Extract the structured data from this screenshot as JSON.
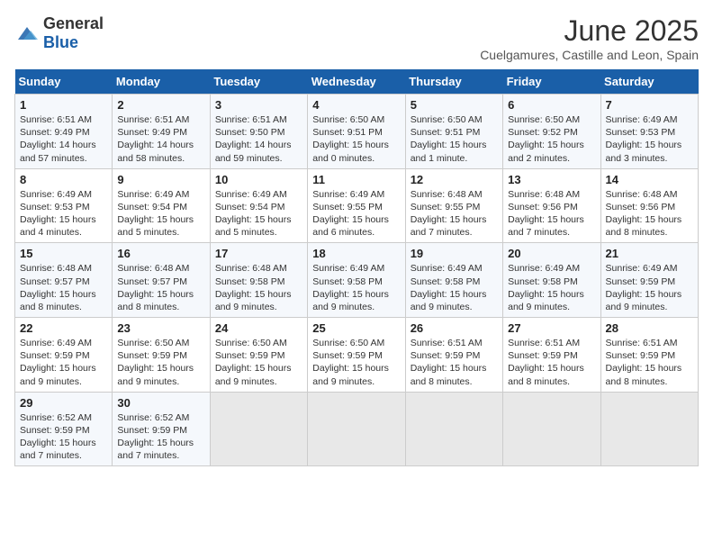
{
  "header": {
    "logo_general": "General",
    "logo_blue": "Blue",
    "title": "June 2025",
    "subtitle": "Cuelgamures, Castille and Leon, Spain"
  },
  "days_of_week": [
    "Sunday",
    "Monday",
    "Tuesday",
    "Wednesday",
    "Thursday",
    "Friday",
    "Saturday"
  ],
  "weeks": [
    [
      {
        "day": "1",
        "sunrise": "6:51 AM",
        "sunset": "9:49 PM",
        "daylight": "14 hours and 57 minutes."
      },
      {
        "day": "2",
        "sunrise": "6:51 AM",
        "sunset": "9:49 PM",
        "daylight": "14 hours and 58 minutes."
      },
      {
        "day": "3",
        "sunrise": "6:51 AM",
        "sunset": "9:50 PM",
        "daylight": "14 hours and 59 minutes."
      },
      {
        "day": "4",
        "sunrise": "6:50 AM",
        "sunset": "9:51 PM",
        "daylight": "15 hours and 0 minutes."
      },
      {
        "day": "5",
        "sunrise": "6:50 AM",
        "sunset": "9:51 PM",
        "daylight": "15 hours and 1 minute."
      },
      {
        "day": "6",
        "sunrise": "6:50 AM",
        "sunset": "9:52 PM",
        "daylight": "15 hours and 2 minutes."
      },
      {
        "day": "7",
        "sunrise": "6:49 AM",
        "sunset": "9:53 PM",
        "daylight": "15 hours and 3 minutes."
      }
    ],
    [
      {
        "day": "8",
        "sunrise": "6:49 AM",
        "sunset": "9:53 PM",
        "daylight": "15 hours and 4 minutes."
      },
      {
        "day": "9",
        "sunrise": "6:49 AM",
        "sunset": "9:54 PM",
        "daylight": "15 hours and 5 minutes."
      },
      {
        "day": "10",
        "sunrise": "6:49 AM",
        "sunset": "9:54 PM",
        "daylight": "15 hours and 5 minutes."
      },
      {
        "day": "11",
        "sunrise": "6:49 AM",
        "sunset": "9:55 PM",
        "daylight": "15 hours and 6 minutes."
      },
      {
        "day": "12",
        "sunrise": "6:48 AM",
        "sunset": "9:55 PM",
        "daylight": "15 hours and 7 minutes."
      },
      {
        "day": "13",
        "sunrise": "6:48 AM",
        "sunset": "9:56 PM",
        "daylight": "15 hours and 7 minutes."
      },
      {
        "day": "14",
        "sunrise": "6:48 AM",
        "sunset": "9:56 PM",
        "daylight": "15 hours and 8 minutes."
      }
    ],
    [
      {
        "day": "15",
        "sunrise": "6:48 AM",
        "sunset": "9:57 PM",
        "daylight": "15 hours and 8 minutes."
      },
      {
        "day": "16",
        "sunrise": "6:48 AM",
        "sunset": "9:57 PM",
        "daylight": "15 hours and 8 minutes."
      },
      {
        "day": "17",
        "sunrise": "6:48 AM",
        "sunset": "9:58 PM",
        "daylight": "15 hours and 9 minutes."
      },
      {
        "day": "18",
        "sunrise": "6:49 AM",
        "sunset": "9:58 PM",
        "daylight": "15 hours and 9 minutes."
      },
      {
        "day": "19",
        "sunrise": "6:49 AM",
        "sunset": "9:58 PM",
        "daylight": "15 hours and 9 minutes."
      },
      {
        "day": "20",
        "sunrise": "6:49 AM",
        "sunset": "9:58 PM",
        "daylight": "15 hours and 9 minutes."
      },
      {
        "day": "21",
        "sunrise": "6:49 AM",
        "sunset": "9:59 PM",
        "daylight": "15 hours and 9 minutes."
      }
    ],
    [
      {
        "day": "22",
        "sunrise": "6:49 AM",
        "sunset": "9:59 PM",
        "daylight": "15 hours and 9 minutes."
      },
      {
        "day": "23",
        "sunrise": "6:50 AM",
        "sunset": "9:59 PM",
        "daylight": "15 hours and 9 minutes."
      },
      {
        "day": "24",
        "sunrise": "6:50 AM",
        "sunset": "9:59 PM",
        "daylight": "15 hours and 9 minutes."
      },
      {
        "day": "25",
        "sunrise": "6:50 AM",
        "sunset": "9:59 PM",
        "daylight": "15 hours and 9 minutes."
      },
      {
        "day": "26",
        "sunrise": "6:51 AM",
        "sunset": "9:59 PM",
        "daylight": "15 hours and 8 minutes."
      },
      {
        "day": "27",
        "sunrise": "6:51 AM",
        "sunset": "9:59 PM",
        "daylight": "15 hours and 8 minutes."
      },
      {
        "day": "28",
        "sunrise": "6:51 AM",
        "sunset": "9:59 PM",
        "daylight": "15 hours and 8 minutes."
      }
    ],
    [
      {
        "day": "29",
        "sunrise": "6:52 AM",
        "sunset": "9:59 PM",
        "daylight": "15 hours and 7 minutes."
      },
      {
        "day": "30",
        "sunrise": "6:52 AM",
        "sunset": "9:59 PM",
        "daylight": "15 hours and 7 minutes."
      },
      null,
      null,
      null,
      null,
      null
    ]
  ]
}
